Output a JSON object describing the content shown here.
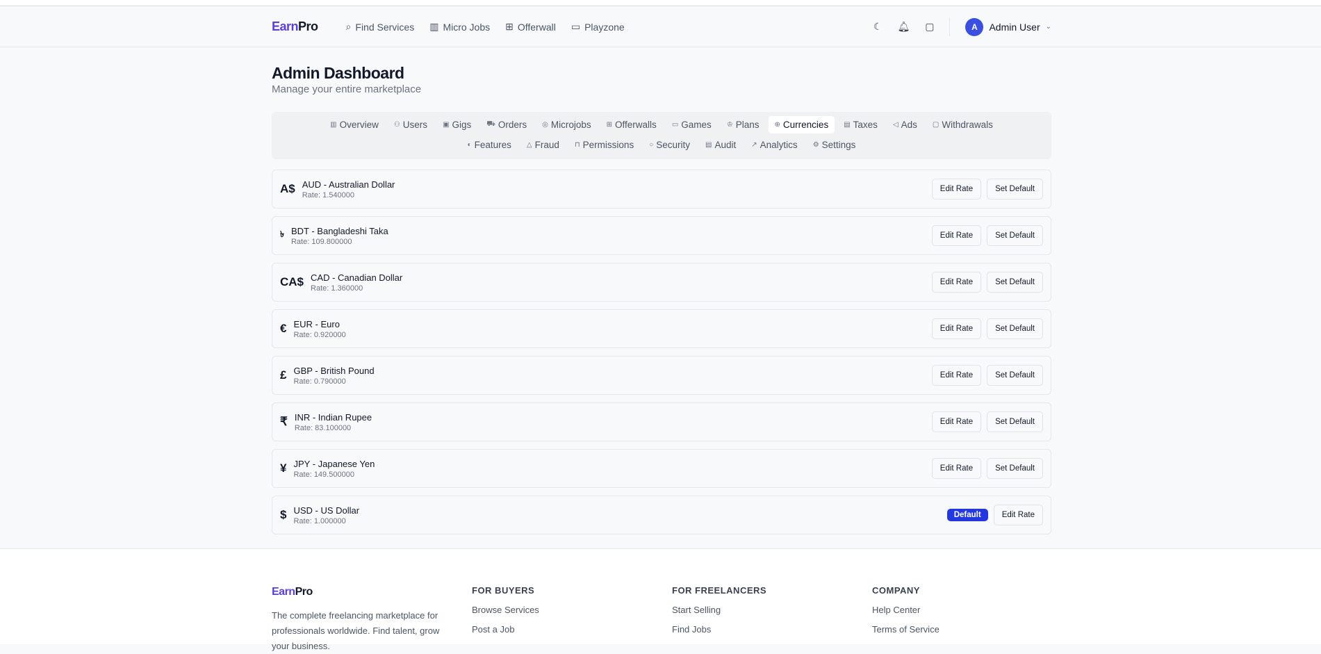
{
  "header": {
    "logo_a": "Earn",
    "logo_b": "Pro",
    "nav": [
      {
        "label": "Find Services",
        "icon": "search-icon"
      },
      {
        "label": "Micro Jobs",
        "icon": "briefcase-icon"
      },
      {
        "label": "Offerwall",
        "icon": "gift-icon"
      },
      {
        "label": "Playzone",
        "icon": "gamepad-icon"
      }
    ],
    "user_initial": "A",
    "user_name": "Admin User"
  },
  "page": {
    "title": "Admin Dashboard",
    "subtitle": "Manage your entire marketplace"
  },
  "tabs_row1": [
    {
      "label": "Overview",
      "icon": "▥"
    },
    {
      "label": "Users",
      "icon": "⚇"
    },
    {
      "label": "Gigs",
      "icon": "▣"
    },
    {
      "label": "Orders",
      "icon": "⛟"
    },
    {
      "label": "Microjobs",
      "icon": "◎"
    },
    {
      "label": "Offerwalls",
      "icon": "⊞"
    },
    {
      "label": "Games",
      "icon": "▭"
    },
    {
      "label": "Plans",
      "icon": "♔"
    },
    {
      "label": "Currencies",
      "icon": "⊕"
    },
    {
      "label": "Taxes",
      "icon": "▤"
    },
    {
      "label": "Ads",
      "icon": "◁"
    },
    {
      "label": "Withdrawals",
      "icon": "▢"
    }
  ],
  "tabs_row2": [
    {
      "label": "Features",
      "icon": "◐"
    },
    {
      "label": "Fraud",
      "icon": "△"
    },
    {
      "label": "Permissions",
      "icon": "⊓"
    },
    {
      "label": "Security",
      "icon": "○"
    },
    {
      "label": "Audit",
      "icon": "▤"
    },
    {
      "label": "Analytics",
      "icon": "↗"
    },
    {
      "label": "Settings",
      "icon": "⚙"
    }
  ],
  "active_tab": "Currencies",
  "currencies": [
    {
      "symbol": "A$",
      "name": "AUD - Australian Dollar",
      "rate": "Rate: 1.540000",
      "default": false
    },
    {
      "symbol": "৳",
      "name": "BDT - Bangladeshi Taka",
      "rate": "Rate: 109.800000",
      "default": false
    },
    {
      "symbol": "CA$",
      "name": "CAD - Canadian Dollar",
      "rate": "Rate: 1.360000",
      "default": false
    },
    {
      "symbol": "€",
      "name": "EUR - Euro",
      "rate": "Rate: 0.920000",
      "default": false
    },
    {
      "symbol": "£",
      "name": "GBP - British Pound",
      "rate": "Rate: 0.790000",
      "default": false
    },
    {
      "symbol": "₹",
      "name": "INR - Indian Rupee",
      "rate": "Rate: 83.100000",
      "default": false
    },
    {
      "symbol": "¥",
      "name": "JPY - Japanese Yen",
      "rate": "Rate: 149.500000",
      "default": false
    },
    {
      "symbol": "$",
      "name": "USD - US Dollar",
      "rate": "Rate: 1.000000",
      "default": true
    }
  ],
  "labels": {
    "edit_rate": "Edit Rate",
    "set_default": "Set Default",
    "default_badge": "Default"
  },
  "footer": {
    "description": "The complete freelancing marketplace for professionals worldwide. Find talent, grow your business.",
    "columns": [
      {
        "heading": "FOR BUYERS",
        "links": [
          "Browse Services",
          "Post a Job"
        ]
      },
      {
        "heading": "FOR FREELANCERS",
        "links": [
          "Start Selling",
          "Find Jobs"
        ]
      },
      {
        "heading": "COMPANY",
        "links": [
          "Help Center",
          "Terms of Service"
        ]
      }
    ]
  },
  "colors": {
    "brand": "#5b3fd6",
    "accent": "#2438e0"
  }
}
